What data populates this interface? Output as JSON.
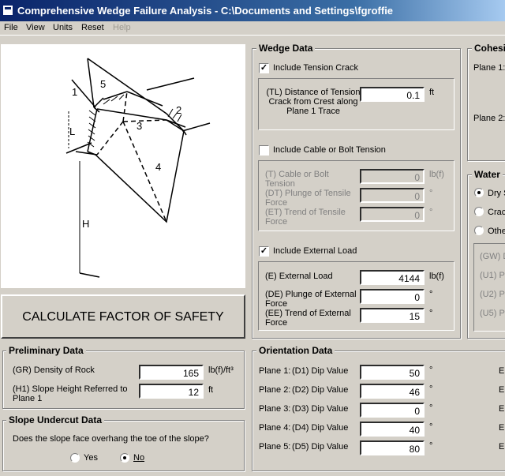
{
  "window": {
    "title": "Comprehensive Wedge Failure Analysis - C:\\Documents and Settings\\fgroffie"
  },
  "menu": [
    {
      "label": "File"
    },
    {
      "label": "View"
    },
    {
      "label": "Units"
    },
    {
      "label": "Reset"
    },
    {
      "label": "Help",
      "disabled": true
    }
  ],
  "diagram": {
    "labels": [
      "1",
      "5",
      "2",
      "3",
      "4",
      "L",
      "H"
    ]
  },
  "calculate_button": "CALCULATE FACTOR OF SAFETY",
  "preliminary": {
    "title": "Preliminary Data",
    "density_label": "(GR) Density of Rock",
    "density_value": "165",
    "density_unit": "lb(f)/ft³",
    "height_label": "(H1) Slope Height Referred to Plane 1",
    "height_value": "12",
    "height_unit": "ft"
  },
  "undercut": {
    "title": "Slope Undercut Data",
    "question": "Does the slope face overhang the toe of the slope?",
    "yes": "Yes",
    "no": "No",
    "selected": "No"
  },
  "wedge": {
    "title": "Wedge Data",
    "tension_check": "Include Tension Crack",
    "tension_checked": true,
    "tl_label": "(TL) Distance of Tension Crack from Crest along Plane 1 Trace",
    "tl_value": "0.1",
    "tl_unit": "ft",
    "cable_check": "Include Cable or Bolt Tension",
    "cable_checked": false,
    "t_label": "(T) Cable or Bolt Tension",
    "t_value": "0",
    "t_unit": "lb(f)",
    "dt_label": "(DT) Plunge of Tensile Force",
    "dt_value": "0",
    "dt_unit": "°",
    "et_label": "(ET) Trend of Tensile Force",
    "et_value": "0",
    "et_unit": "°",
    "ext_check": "Include External Load",
    "ext_checked": true,
    "e_label": "(E) External Load",
    "e_value": "4144",
    "e_unit": "lb(f)",
    "de_label": "(DE) Plunge of External Force",
    "de_value": "0",
    "de_unit": "°",
    "ee_label": "(EE) Trend of External Force",
    "ee_value": "15",
    "ee_unit": "°"
  },
  "cohesion": {
    "title": "Cohesi",
    "plane1": "Plane 1:",
    "plane2": "Plane 2:"
  },
  "water": {
    "title": "Water",
    "options": [
      "Dry S",
      "Crac",
      "Othe"
    ],
    "fields": [
      "(GW) D",
      "(U1) P",
      "(U2) P",
      "(U5) P"
    ]
  },
  "orientation": {
    "title": "Orientation Data",
    "rows": [
      {
        "plane": "Plane 1:",
        "label": "(D1) Dip Value",
        "value": "50",
        "unit": "°",
        "tail": "E"
      },
      {
        "plane": "Plane 2:",
        "label": "(D2) Dip Value",
        "value": "46",
        "unit": "°",
        "tail": "E"
      },
      {
        "plane": "Plane 3:",
        "label": "(D3) Dip Value",
        "value": "0",
        "unit": "°",
        "tail": "E"
      },
      {
        "plane": "Plane 4:",
        "label": "(D4) Dip Value",
        "value": "40",
        "unit": "°",
        "tail": "E"
      },
      {
        "plane": "Plane 5:",
        "label": "(D5) Dip Value",
        "value": "80",
        "unit": "°",
        "tail": "E"
      }
    ]
  }
}
